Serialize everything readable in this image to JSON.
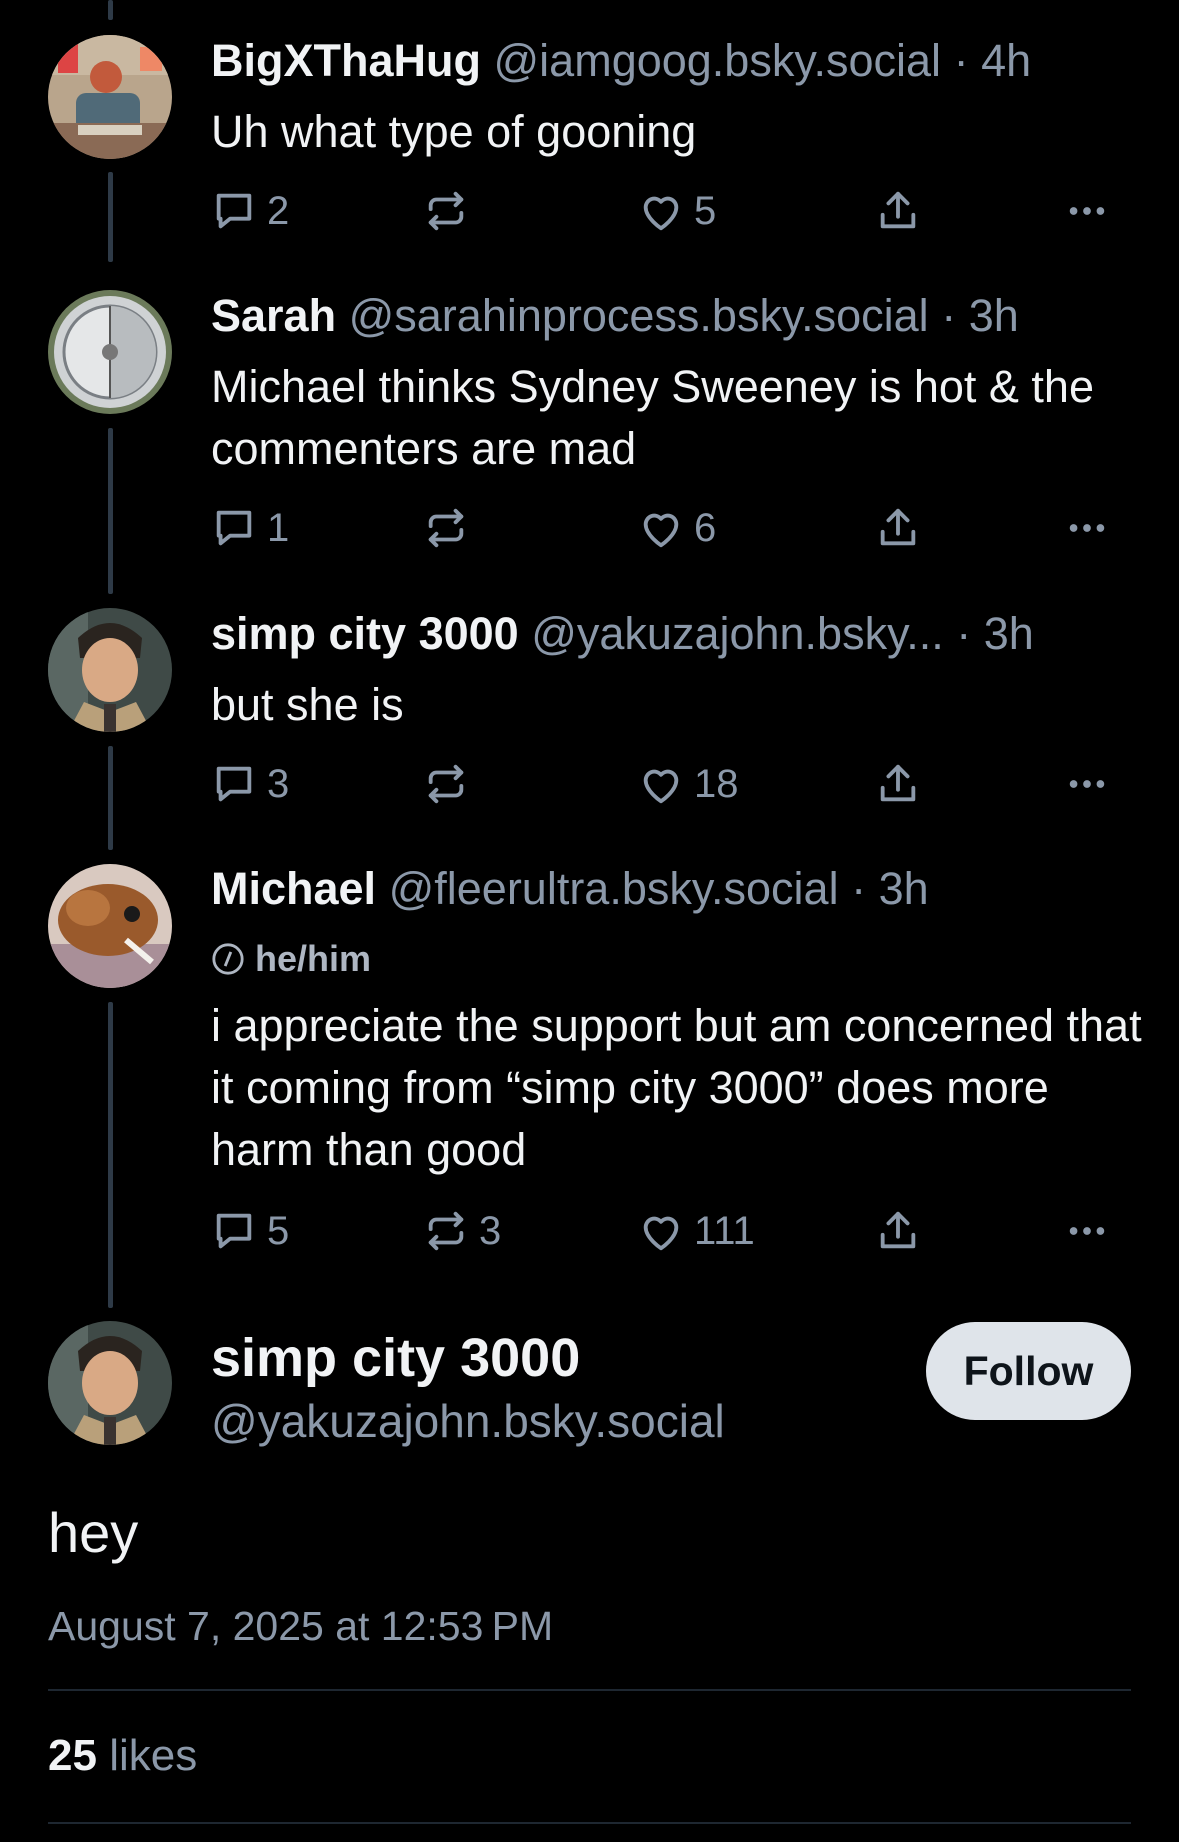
{
  "posts": [
    {
      "name": "BigXThaHug",
      "handle": "@iamgoog.bsky.social",
      "time": "4h",
      "text": "Uh what type of gooning",
      "replies": "2",
      "reposts": "",
      "likes": "5"
    },
    {
      "name": "Sarah",
      "handle": "@sarahinprocess.bsky.social",
      "time": "3h",
      "text": "Michael thinks Sydney Sweeney is hot & the commenters are mad",
      "replies": "1",
      "reposts": "",
      "likes": "6"
    },
    {
      "name": "simp city 3000",
      "handle": "@yakuzajohn.bsky...",
      "time": "3h",
      "text": "but she is",
      "replies": "3",
      "reposts": "",
      "likes": "18"
    },
    {
      "name": "Michael",
      "handle": "@fleerultra.bsky.social",
      "time": "3h",
      "pronouns": "he/him",
      "text": "i appreciate the support but am concerned that it coming from “simp city 3000” does more harm than good",
      "replies": "5",
      "reposts": "3",
      "likes": "111"
    }
  ],
  "separator": "·",
  "main_post": {
    "name": "simp city 3000",
    "handle": "@yakuzajohn.bsky.social",
    "follow_label": "Follow",
    "text": "hey",
    "date": "August 7, 2025 at 12:53 PM",
    "like_count": "25",
    "like_label": "likes"
  },
  "icons": {
    "reply": "reply-icon",
    "repost": "repost-icon",
    "like": "heart-icon",
    "share": "share-icon",
    "more": "more-icon",
    "pronoun": "info-icon"
  },
  "colors": {
    "background": "#000000",
    "text": "#f1f3f5",
    "muted": "#8b98a9",
    "thread_line": "#2e3a47",
    "follow_button_bg": "#dfe4ea"
  }
}
